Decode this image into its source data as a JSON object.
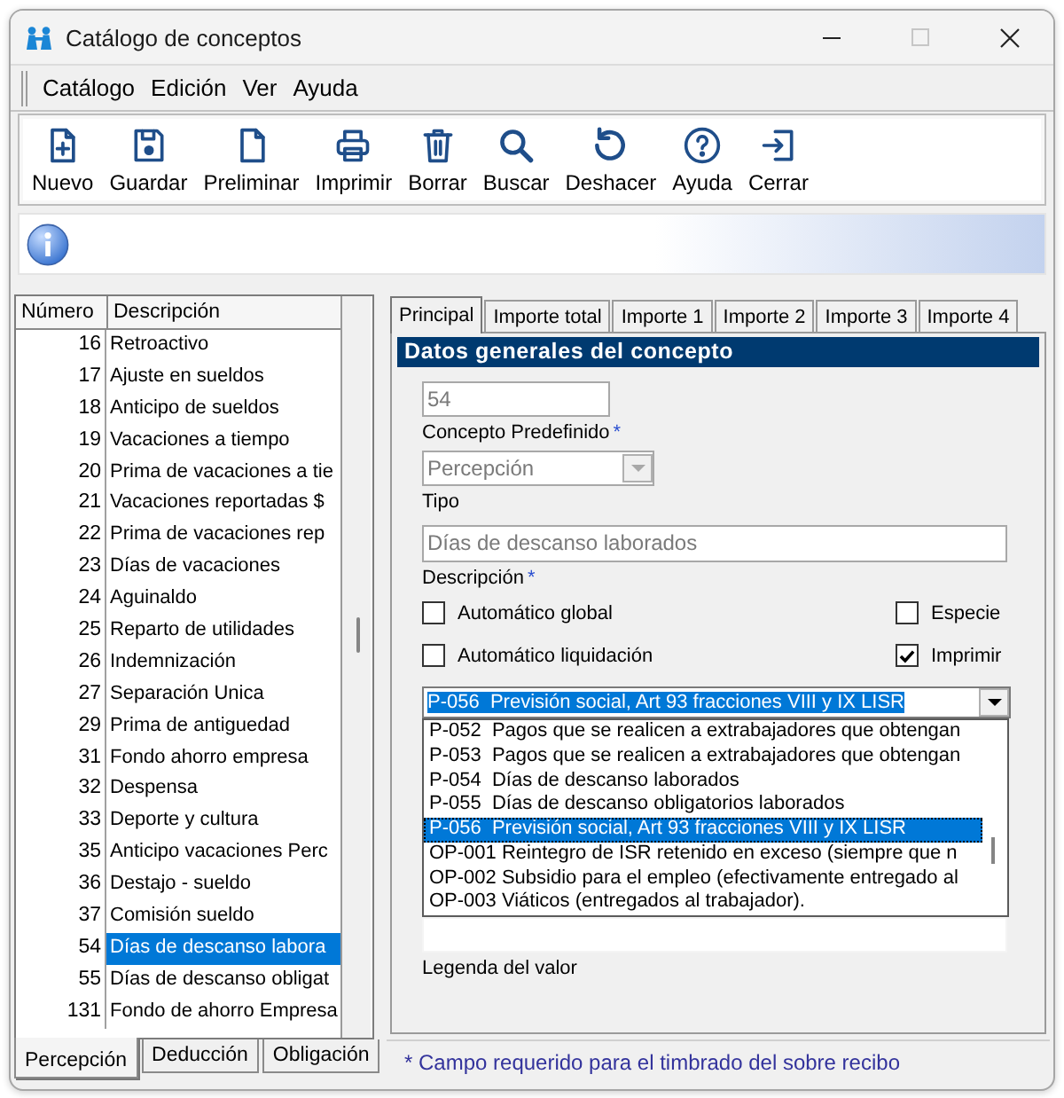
{
  "window": {
    "title": "Catálogo de conceptos",
    "maximize_disabled": true
  },
  "menu": [
    {
      "label": "Catálogo"
    },
    {
      "label": "Edición"
    },
    {
      "label": "Ver"
    },
    {
      "label": "Ayuda"
    }
  ],
  "toolbar": [
    {
      "kind": "new",
      "label": "Nuevo"
    },
    {
      "kind": "save",
      "label": "Guardar"
    },
    {
      "kind": "preview",
      "label": "Preliminar"
    },
    {
      "kind": "print",
      "label": "Imprimir"
    },
    {
      "kind": "delete",
      "label": "Borrar"
    },
    {
      "kind": "search",
      "label": "Buscar"
    },
    {
      "kind": "undo",
      "label": "Deshacer"
    },
    {
      "kind": "help",
      "label": "Ayuda"
    },
    {
      "kind": "exit",
      "label": "Cerrar"
    }
  ],
  "list": {
    "columns": [
      "Número",
      "Descripción"
    ],
    "rows": [
      {
        "number": "16",
        "description": "Retroactivo",
        "selected": false
      },
      {
        "number": "17",
        "description": "Ajuste en sueldos",
        "selected": false
      },
      {
        "number": "18",
        "description": "Anticipo de sueldos",
        "selected": false
      },
      {
        "number": "19",
        "description": "Vacaciones a tiempo",
        "selected": false
      },
      {
        "number": "20",
        "description": "Prima de vacaciones a tie",
        "selected": false
      },
      {
        "number": "21",
        "description": "Vacaciones reportadas $",
        "selected": false
      },
      {
        "number": "22",
        "description": "Prima de vacaciones rep",
        "selected": false
      },
      {
        "number": "23",
        "description": "Días de vacaciones",
        "selected": false
      },
      {
        "number": "24",
        "description": "Aguinaldo",
        "selected": false
      },
      {
        "number": "25",
        "description": "Reparto de utilidades",
        "selected": false
      },
      {
        "number": "26",
        "description": "Indemnización",
        "selected": false
      },
      {
        "number": "27",
        "description": "Separación Unica",
        "selected": false
      },
      {
        "number": "29",
        "description": "Prima de antiguedad",
        "selected": false
      },
      {
        "number": "31",
        "description": "Fondo ahorro empresa",
        "selected": false
      },
      {
        "number": "32",
        "description": "Despensa",
        "selected": false
      },
      {
        "number": "33",
        "description": "Deporte y cultura",
        "selected": false
      },
      {
        "number": "35",
        "description": "Anticipo vacaciones Perc",
        "selected": false
      },
      {
        "number": "36",
        "description": "Destajo - sueldo",
        "selected": false
      },
      {
        "number": "37",
        "description": "Comisión sueldo",
        "selected": false
      },
      {
        "number": "54",
        "description": "Días de descanso labora",
        "selected": true
      },
      {
        "number": "55",
        "description": "Días de descanso obligat",
        "selected": false
      },
      {
        "number": "131",
        "description": "Fondo de ahorro Empresa",
        "selected": false
      }
    ]
  },
  "list_tabs": [
    {
      "label": "Percepción",
      "selected": true
    },
    {
      "label": "Deducción",
      "selected": false
    },
    {
      "label": "Obligación",
      "selected": false
    }
  ],
  "form": {
    "tabs": [
      {
        "label": "Principal",
        "selected": true
      },
      {
        "label": "Importe total",
        "selected": false
      },
      {
        "label": "Importe 1",
        "selected": false
      },
      {
        "label": "Importe 2",
        "selected": false
      },
      {
        "label": "Importe 3",
        "selected": false
      },
      {
        "label": "Importe 4",
        "selected": false
      }
    ],
    "section_title": "Datos generales del concepto",
    "concept_number": {
      "value": "54",
      "label": "Concepto Predefinido",
      "required_mark": "*",
      "disabled": true
    },
    "type": {
      "value": "Percepción",
      "label": "Tipo",
      "disabled": true
    },
    "description": {
      "value": "Días de descanso laborados",
      "label": "Descripción",
      "required_mark": "*",
      "disabled": true
    },
    "options": [
      {
        "label": "Automático global",
        "checked": false
      },
      {
        "label": "Especie",
        "checked": false
      },
      {
        "label": "Automático liquidación",
        "checked": false
      },
      {
        "label": "Imprimir",
        "checked": true
      }
    ],
    "sat_code": {
      "value": "P-056  Previsión social, Art 93 fracciones VIII y IX LISR",
      "focused": true,
      "expanded": true,
      "options": [
        {
          "label": "P-052  Pagos que se realicen a extrabajadores que obtengan",
          "selected": false
        },
        {
          "label": "P-053  Pagos que se realicen a extrabajadores que obtengan",
          "selected": false
        },
        {
          "label": "P-054  Días de descanso laborados",
          "selected": false
        },
        {
          "label": "P-055  Días de descanso obligatorios laborados",
          "selected": false
        },
        {
          "label": "P-056  Previsión social, Art 93 fracciones VIII y IX LISR",
          "selected": true
        },
        {
          "label": "OP-001 Reintegro de ISR retenido en exceso (siempre que n",
          "selected": false
        },
        {
          "label": "OP-002 Subsidio para el empleo (efectivamente entregado al",
          "selected": false
        },
        {
          "label": "OP-003 Viáticos (entregados al trabajador).",
          "selected": false
        }
      ]
    },
    "legend": {
      "label": "Legenda del valor"
    }
  },
  "status_bar": "* Campo requerido para el timbrado del sobre recibo"
}
